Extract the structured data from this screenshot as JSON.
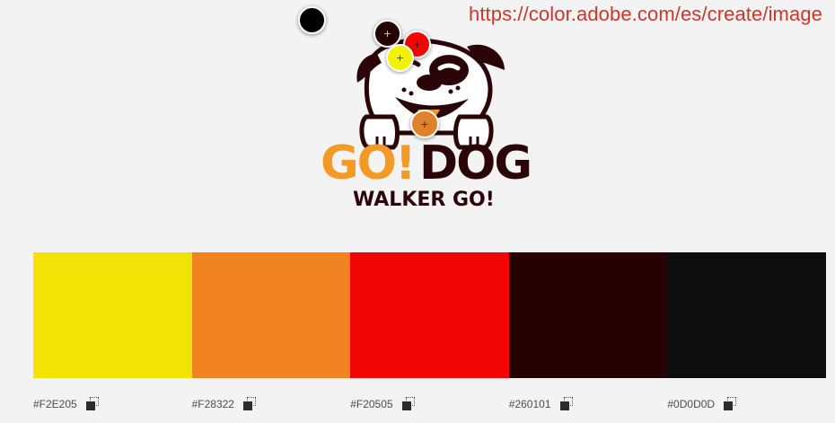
{
  "overlay": {
    "url": "https://color.adobe.com/es/create/image"
  },
  "logo": {
    "word_go": "GO!",
    "word_dog": "DOG",
    "tagline": "WALKER GO!",
    "colors": {
      "orange": "#f29a25",
      "dark": "#2a0406",
      "white": "#ffffff"
    }
  },
  "pickers": [
    {
      "color": "#000000",
      "name": "picker-black"
    },
    {
      "color": "#260101",
      "name": "picker-dark-brown"
    },
    {
      "color": "#f20505",
      "name": "picker-red"
    },
    {
      "color": "#f2e205",
      "name": "picker-yellow"
    },
    {
      "color": "#f28322",
      "name": "picker-orange"
    }
  ],
  "palette": [
    {
      "hex": "#F2E205",
      "color": "#f2e205"
    },
    {
      "hex": "#F28322",
      "color": "#f28322"
    },
    {
      "hex": "#F20505",
      "color": "#f20505"
    },
    {
      "hex": "#260101",
      "color": "#260101"
    },
    {
      "hex": "#0D0D0D",
      "color": "#0d0d0d"
    }
  ],
  "icons": {
    "copy": "copy-icon",
    "crosshair": "crosshair-icon"
  }
}
